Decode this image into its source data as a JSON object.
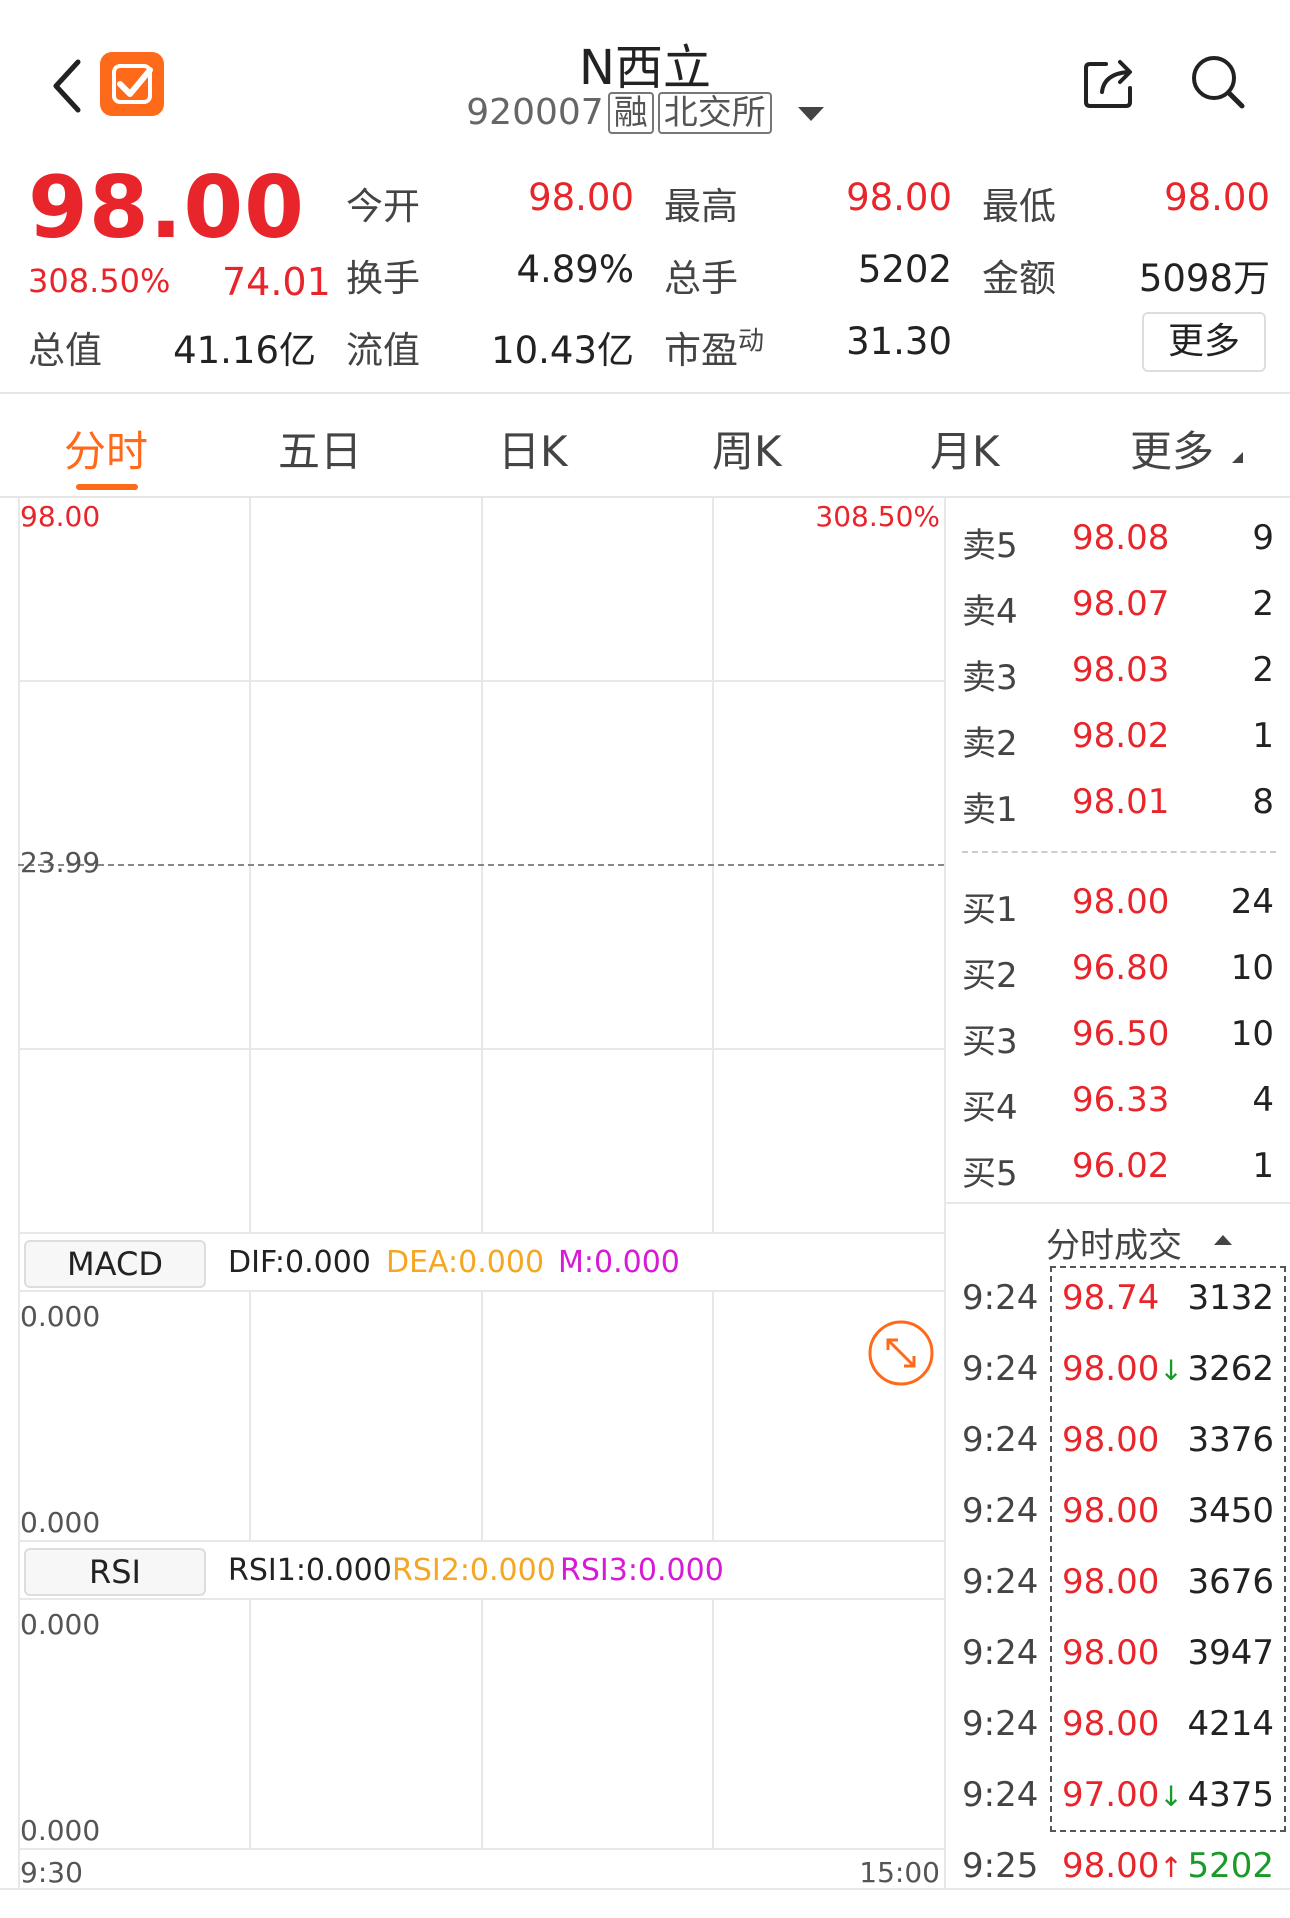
{
  "header": {
    "title": "N西立",
    "code": "920007",
    "tag_margin": "融",
    "tag_exchange": "北交所"
  },
  "quote": {
    "price": "98.00",
    "change_pct": "308.50%",
    "change": "74.01",
    "open_label": "今开",
    "open": "98.00",
    "high_label": "最高",
    "high": "98.00",
    "low_label": "最低",
    "low": "98.00",
    "turnover_label": "换手",
    "turnover": "4.89%",
    "volume_label": "总手",
    "volume": "5202",
    "amount_label": "金额",
    "amount": "5098万",
    "mktcap_label": "总值",
    "mktcap": "41.16亿",
    "float_label": "流值",
    "float": "10.43亿",
    "pe_label": "市盈",
    "pe_sup": "动",
    "pe": "31.30",
    "more_label": "更多"
  },
  "tabs": [
    {
      "label": "分时",
      "active": true
    },
    {
      "label": "五日",
      "active": false
    },
    {
      "label": "日K",
      "active": false
    },
    {
      "label": "周K",
      "active": false
    },
    {
      "label": "月K",
      "active": false
    },
    {
      "label": "更多",
      "active": false
    }
  ],
  "chart": {
    "price_top": "98.00",
    "pct_top": "308.50%",
    "prev_close": "23.99",
    "time_start": "9:30",
    "time_end": "15:00"
  },
  "macd": {
    "label": "MACD",
    "dif": "DIF:0.000",
    "dea": "DEA:0.000",
    "m": "M:0.000",
    "top": "0.000",
    "bottom": "0.000",
    "dea_color": "#f5a623",
    "m_color": "#d61ad6"
  },
  "rsi": {
    "label": "RSI",
    "rsi1": "RSI1:0.000",
    "rsi2": "RSI2:0.000",
    "rsi3": "RSI3:0.000",
    "top": "0.000",
    "bottom": "0.000"
  },
  "order_book": {
    "asks": [
      {
        "label": "卖5",
        "price": "98.08",
        "vol": "9"
      },
      {
        "label": "卖4",
        "price": "98.07",
        "vol": "2"
      },
      {
        "label": "卖3",
        "price": "98.03",
        "vol": "2"
      },
      {
        "label": "卖2",
        "price": "98.02",
        "vol": "1"
      },
      {
        "label": "卖1",
        "price": "98.01",
        "vol": "8"
      }
    ],
    "bids": [
      {
        "label": "买1",
        "price": "98.00",
        "vol": "24"
      },
      {
        "label": "买2",
        "price": "96.80",
        "vol": "10"
      },
      {
        "label": "买3",
        "price": "96.50",
        "vol": "10"
      },
      {
        "label": "买4",
        "price": "96.33",
        "vol": "4"
      },
      {
        "label": "买5",
        "price": "96.02",
        "vol": "1"
      }
    ]
  },
  "ticks": {
    "title": "分时成交",
    "rows": [
      {
        "time": "9:24",
        "price": "98.74",
        "dir": "",
        "vol": "3132"
      },
      {
        "time": "9:24",
        "price": "98.00",
        "dir": "↓",
        "vol": "3262"
      },
      {
        "time": "9:24",
        "price": "98.00",
        "dir": "",
        "vol": "3376"
      },
      {
        "time": "9:24",
        "price": "98.00",
        "dir": "",
        "vol": "3450"
      },
      {
        "time": "9:24",
        "price": "98.00",
        "dir": "",
        "vol": "3676"
      },
      {
        "time": "9:24",
        "price": "98.00",
        "dir": "",
        "vol": "3947"
      },
      {
        "time": "9:24",
        "price": "98.00",
        "dir": "",
        "vol": "4214"
      },
      {
        "time": "9:24",
        "price": "97.00",
        "dir": "↓",
        "vol": "4375"
      },
      {
        "time": "9:25",
        "price": "98.00",
        "dir": "↑",
        "vol": "5202"
      }
    ]
  },
  "colors": {
    "up": "#e8252b",
    "down": "#1a9a2a",
    "accent": "#ff6a1a"
  },
  "icons": [
    "back-icon",
    "app-logo-icon",
    "share-icon",
    "search-icon",
    "expand-icon"
  ]
}
